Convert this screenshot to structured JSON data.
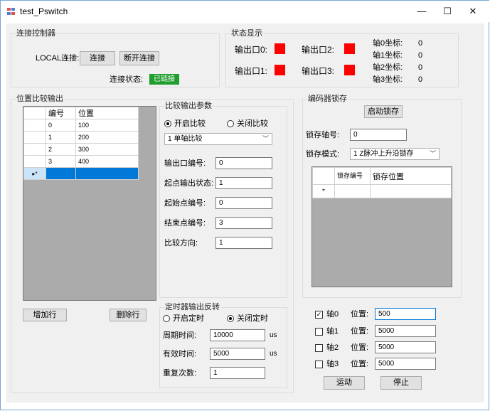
{
  "window": {
    "title": "test_Pswitch",
    "minimize_glyph": "—",
    "maximize_glyph": "☐",
    "close_glyph": "✕"
  },
  "connect": {
    "group_title": "连接控制器",
    "local_label": "LOCAL连接:",
    "connect_btn": "连接",
    "disconnect_btn": "断开连接",
    "status_label": "连接状态:",
    "status_value": "已链接",
    "status_color": "#1f9d2d"
  },
  "status": {
    "group_title": "状态显示",
    "outputs": [
      "输出口0:",
      "输出口2:",
      "输出口1:",
      "输出口3:"
    ],
    "indicator_color": "#ff0000",
    "coords": [
      {
        "label": "轴0坐标:",
        "value": "0"
      },
      {
        "label": "轴1坐标:",
        "value": "0"
      },
      {
        "label": "轴2坐标:",
        "value": "0"
      },
      {
        "label": "轴3坐标:",
        "value": "0"
      }
    ]
  },
  "pos_compare": {
    "group_title": "位置比较输出",
    "columns": [
      "编号",
      "位置"
    ],
    "rows": [
      {
        "id": "0",
        "pos": "100"
      },
      {
        "id": "1",
        "pos": "200"
      },
      {
        "id": "2",
        "pos": "300"
      },
      {
        "id": "3",
        "pos": "400"
      }
    ],
    "new_row_marker": "▸*",
    "add_row_btn": "增加行",
    "del_row_btn": "删除行"
  },
  "compare_params": {
    "group_title": "比较输出参数",
    "radio_on": "开启比较",
    "radio_off": "关闭比较",
    "mode": "1 单轴比较",
    "fields": [
      {
        "label": "输出口编号:",
        "value": "0"
      },
      {
        "label": "起点输出状态:",
        "value": "1"
      },
      {
        "label": "起始点编号:",
        "value": "0"
      },
      {
        "label": "结束点编号:",
        "value": "3"
      },
      {
        "label": "比较方向:",
        "value": "1"
      }
    ]
  },
  "timer": {
    "group_title": "定时器输出反转",
    "radio_on": "开启定时",
    "radio_off": "关闭定时",
    "period_label": "周期时间:",
    "period_value": "10000",
    "period_unit": "us",
    "valid_label": "有效时间:",
    "valid_value": "5000",
    "valid_unit": "us",
    "repeat_label": "重复次数:",
    "repeat_value": "1"
  },
  "encoder": {
    "group_title": "编码器锁存",
    "start_btn": "启动锁存",
    "axis_label": "锁存轴号:",
    "axis_value": "0",
    "mode_label": "锁存模式:",
    "mode_value": "1 Z脉冲上升沿锁存",
    "col_id": "锁存编号",
    "col_pos": "锁存位置",
    "new_row_marker": "*"
  },
  "axes": {
    "rows": [
      {
        "checked": true,
        "label": "轴0",
        "pos_label": "位置:",
        "value": "500"
      },
      {
        "checked": false,
        "label": "轴1",
        "pos_label": "位置:",
        "value": "5000"
      },
      {
        "checked": false,
        "label": "轴2",
        "pos_label": "位置:",
        "value": "5000"
      },
      {
        "checked": false,
        "label": "轴3",
        "pos_label": "位置:",
        "value": "5000"
      }
    ],
    "run_btn": "运动",
    "stop_btn": "停止"
  }
}
